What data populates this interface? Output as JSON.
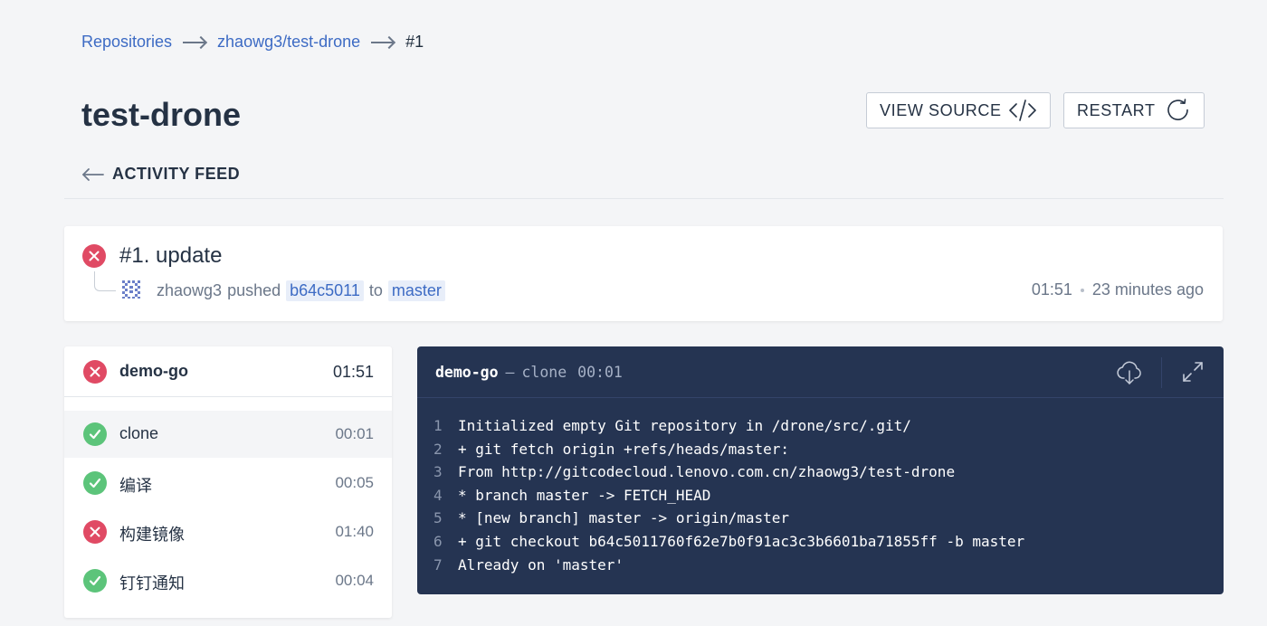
{
  "breadcrumb": {
    "repositories": "Repositories",
    "repo": "zhaowg3/test-drone",
    "build": "#1"
  },
  "title": "test-drone",
  "buttons": {
    "view_source": "VIEW SOURCE",
    "restart": "RESTART"
  },
  "back": "ACTIVITY FEED",
  "build": {
    "title": "#1. update",
    "author": "zhaowg3",
    "action": "pushed",
    "commit": "b64c5011",
    "to": "to",
    "branch": "master",
    "duration": "01:51",
    "ago": "23 minutes ago"
  },
  "stage": {
    "name": "demo-go",
    "duration": "01:51",
    "steps": [
      {
        "name": "clone",
        "duration": "00:01",
        "status": "success"
      },
      {
        "name": "编译",
        "duration": "00:05",
        "status": "success"
      },
      {
        "name": "构建镜像",
        "duration": "01:40",
        "status": "failure"
      },
      {
        "name": "钉钉通知",
        "duration": "00:04",
        "status": "success"
      }
    ]
  },
  "log": {
    "stage": "demo-go",
    "separator": "—",
    "step": "clone",
    "time": "00:01",
    "lines": [
      {
        "n": "1",
        "t": "Initialized empty Git repository in /drone/src/.git/"
      },
      {
        "n": "2",
        "t": "+ git fetch origin +refs/heads/master:"
      },
      {
        "n": "3",
        "t": "From http://gitcodecloud.lenovo.com.cn/zhaowg3/test-drone"
      },
      {
        "n": "4",
        "t": "* branch master -> FETCH_HEAD"
      },
      {
        "n": "5",
        "t": "* [new branch] master -> origin/master"
      },
      {
        "n": "6",
        "t": "+ git checkout b64c5011760f62e7b0f91ac3c3b6601ba71855ff -b master"
      },
      {
        "n": "7",
        "t": "Already on 'master'"
      }
    ]
  },
  "colors": {
    "link": "#3d6bc4",
    "failure": "#e04a64",
    "success": "#5cc47a",
    "log_bg": "#253452"
  },
  "icons": [
    "arrow-right-icon",
    "code-icon",
    "refresh-icon",
    "arrow-left-icon",
    "x-icon",
    "check-icon",
    "avatar-icon",
    "cloud-download-icon",
    "expand-icon"
  ]
}
